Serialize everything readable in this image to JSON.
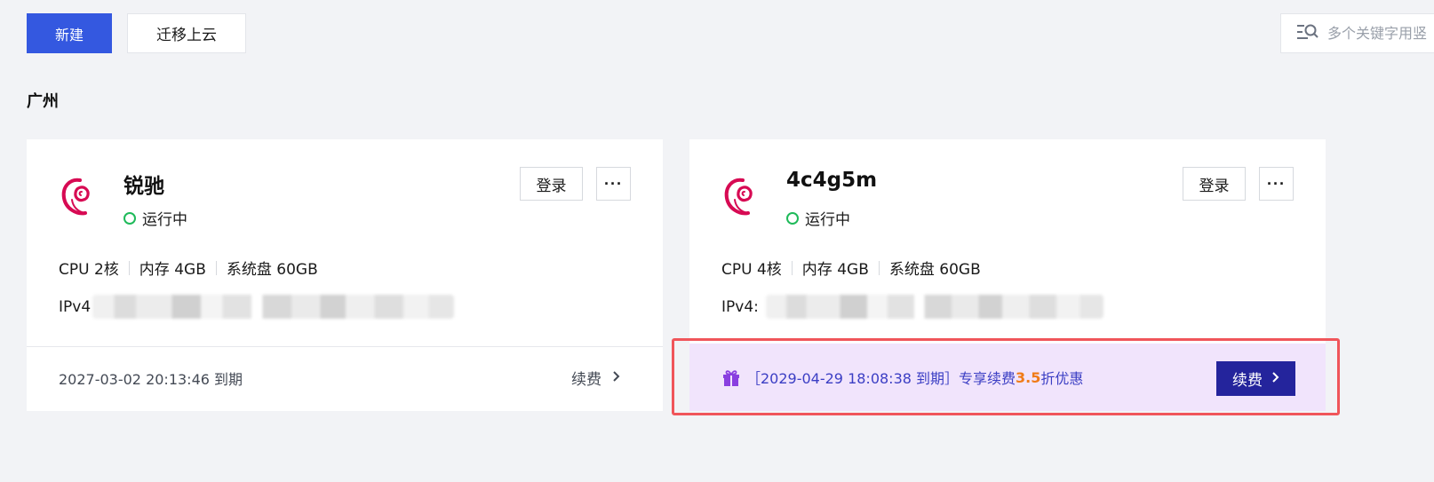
{
  "toolbar": {
    "new_label": "新建",
    "migrate_label": "迁移上云",
    "search_placeholder": "多个关键字用竖"
  },
  "region": "广州",
  "instances": [
    {
      "name": "锐驰",
      "status": "运行中",
      "login_label": "登录",
      "more_label": "···",
      "specs": [
        "CPU 2核",
        "内存 4GB",
        "系统盘 60GB"
      ],
      "ip_label": "IPv4",
      "expire_text": "2027-03-02 20:13:46 到期",
      "renew_label": "续费",
      "renew_arrow": "›"
    },
    {
      "name": "4c4g5m",
      "status": "运行中",
      "login_label": "登录",
      "more_label": "···",
      "specs": [
        "CPU 4核",
        "内存 4GB",
        "系统盘 60GB"
      ],
      "ip_label": "IPv4:",
      "promo": {
        "prefix": "［2029-04-29 18:08:38 到期］专享续费",
        "discount": "3.5",
        "suffix": "折优惠",
        "button_label": "续费",
        "button_arrow": "›"
      }
    }
  ],
  "colors": {
    "primary": "#3458e0",
    "status_running": "#1fba5a",
    "promo_bg": "#f1e4fc",
    "promo_text": "#3b3ec4",
    "discount": "#f07b18",
    "renew_button": "#24249c",
    "highlight_border": "#f0555a",
    "debian_logo": "#d70a53"
  },
  "icons": {
    "search": "search-list-icon",
    "os": "debian-swirl-icon",
    "gift": "gift-icon",
    "chevron": "chevron-right-icon"
  }
}
